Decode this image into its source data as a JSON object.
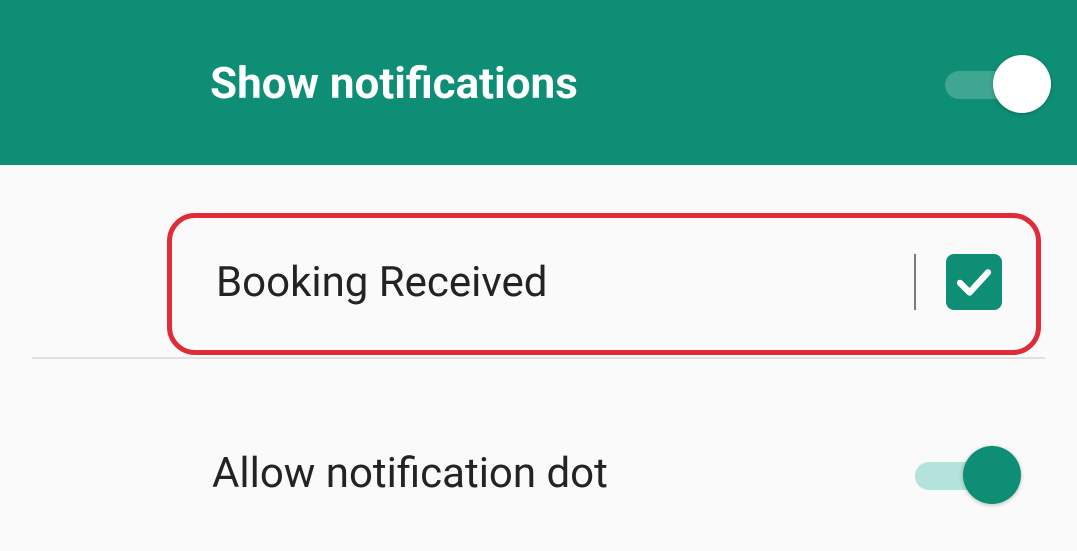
{
  "header": {
    "title": "Show notifications",
    "toggle_on": true
  },
  "items": [
    {
      "label": "Booking Received",
      "checked": true,
      "highlighted": true
    }
  ],
  "allow_dot": {
    "label": "Allow notification dot",
    "toggle_on": true
  }
}
